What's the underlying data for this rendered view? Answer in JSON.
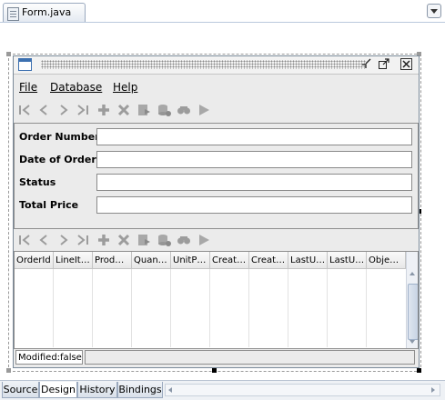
{
  "editor": {
    "file_tab": "Form.java"
  },
  "form": {
    "menus": [
      "File",
      "Database",
      "Help"
    ],
    "fields": [
      {
        "label": "Order Number",
        "value": ""
      },
      {
        "label": "Date of Order",
        "value": ""
      },
      {
        "label": "Status",
        "value": ""
      },
      {
        "label": "Total Price",
        "value": ""
      }
    ],
    "toolbar_icons": [
      "first-icon",
      "previous-icon",
      "next-icon",
      "last-icon",
      "add-icon",
      "delete-icon",
      "save-icon",
      "refresh-icon",
      "search-icon",
      "run-icon"
    ],
    "table": {
      "columns": [
        "OrderId",
        "LineIt…",
        "Prod…",
        "Quan…",
        "UnitP…",
        "Creat…",
        "Creat…",
        "LastU…",
        "LastU…",
        "Obje…"
      ]
    },
    "status": "Modified:false"
  },
  "views": {
    "tabs": [
      "Source",
      "Design",
      "History",
      "Bindings"
    ],
    "active": "Design"
  },
  "colors": {
    "frame_bg": "#ebebeb",
    "accent": "#3c70b0",
    "disabled_icon": "#9c9c9c"
  }
}
